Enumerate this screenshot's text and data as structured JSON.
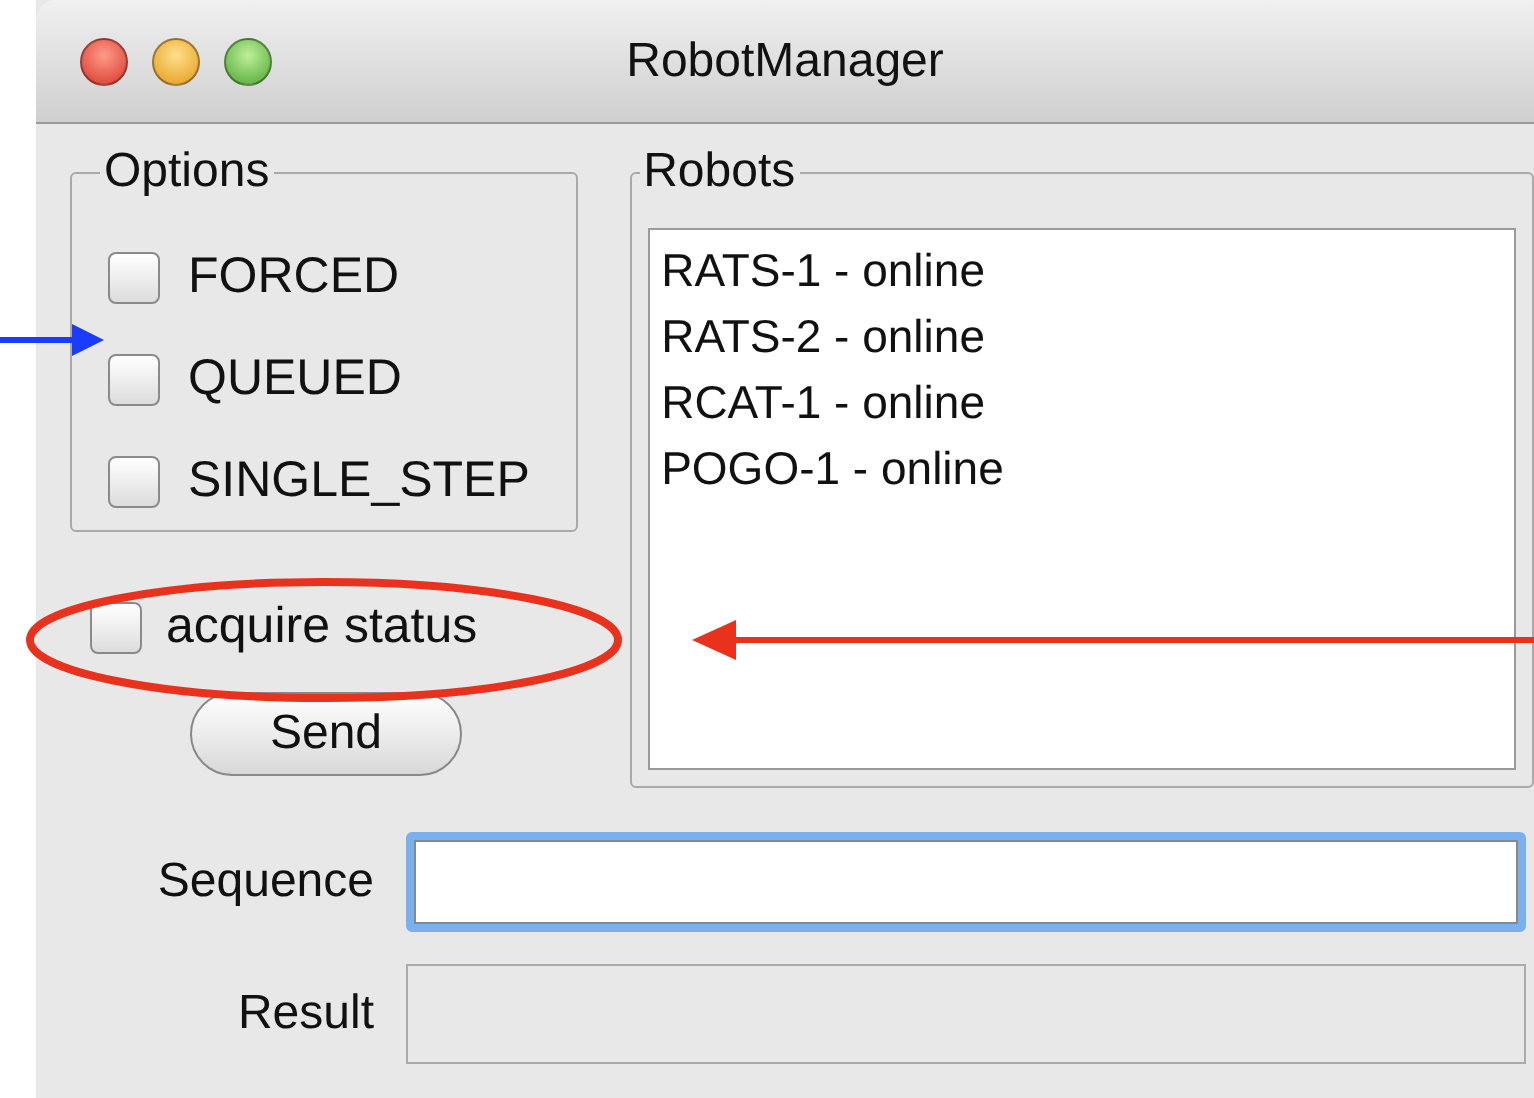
{
  "window": {
    "title": "RobotManager"
  },
  "options": {
    "title": "Options",
    "items": [
      {
        "label": "FORCED",
        "checked": false
      },
      {
        "label": "QUEUED",
        "checked": false
      },
      {
        "label": "SINGLE_STEP",
        "checked": false
      }
    ]
  },
  "acquire_status": {
    "label": "acquire status",
    "checked": false
  },
  "send_button": {
    "label": "Send"
  },
  "robots": {
    "title": "Robots",
    "items": [
      {
        "label": "RATS-1 - online",
        "selected": false
      },
      {
        "label": "RATS-2 - online",
        "selected": false
      },
      {
        "label": "RCAT-1 - online",
        "selected": false
      },
      {
        "label": "POGO-1 - online",
        "selected": false
      }
    ]
  },
  "sequence": {
    "label": "Sequence",
    "focused": true
  },
  "result": {
    "label": "Result",
    "disabled": true
  }
}
